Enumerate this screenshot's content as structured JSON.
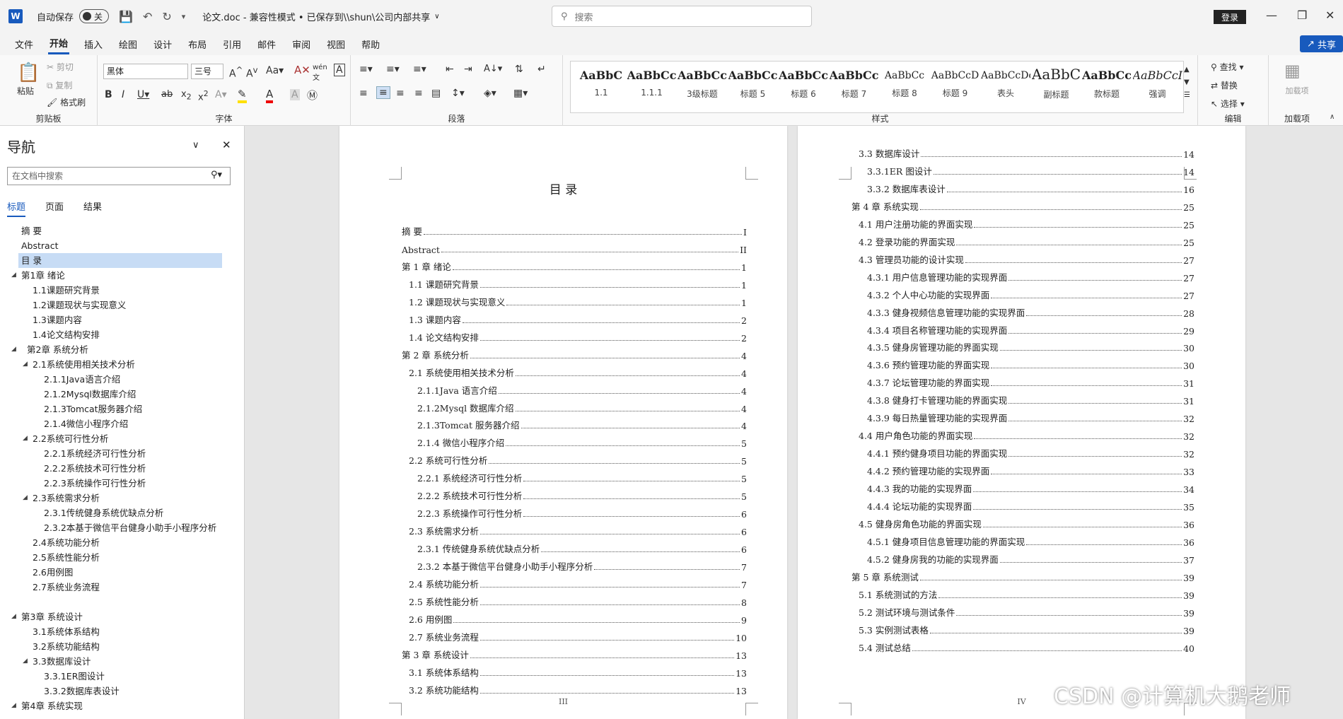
{
  "titlebar": {
    "autosave_label": "自动保存",
    "autosave_state": "关",
    "doc_title": "论文.doc  -  兼容性模式 • 已保存到\\\\shun\\公司内部共享",
    "search_placeholder": "搜索",
    "login": "登录"
  },
  "menu": [
    "文件",
    "开始",
    "插入",
    "绘图",
    "设计",
    "布局",
    "引用",
    "邮件",
    "审阅",
    "视图",
    "帮助"
  ],
  "share": "共享",
  "ribbon": {
    "clipboard": {
      "paste": "粘贴",
      "cut": "剪切",
      "copy": "复制",
      "format_painter": "格式刷",
      "label": "剪贴板"
    },
    "font": {
      "name": "黑体",
      "size": "三号",
      "label": "字体"
    },
    "paragraph": {
      "label": "段落"
    },
    "styles": {
      "label": "样式",
      "items": [
        {
          "sample": "AaBbC",
          "name": "1.1"
        },
        {
          "sample": "AaBbCcI",
          "name": "1.1.1"
        },
        {
          "sample": "AaBbCcI",
          "name": "3级标题"
        },
        {
          "sample": "AaBbCcI",
          "name": "标题 5"
        },
        {
          "sample": "AaBbCc",
          "name": "标题 6"
        },
        {
          "sample": "AaBbCcI",
          "name": "标题 7"
        },
        {
          "sample": "AaBbCc",
          "name": "标题 8"
        },
        {
          "sample": "AaBbCcD",
          "name": "标题 9"
        },
        {
          "sample": "AaBbCcDc",
          "name": "表头"
        },
        {
          "sample": "AaBbC",
          "name": "副标题"
        },
        {
          "sample": "AaBbCcI",
          "name": "款标题"
        },
        {
          "sample": "AaBbCcI",
          "name": "强调"
        }
      ]
    },
    "editing": {
      "find": "查找",
      "replace": "替换",
      "select": "选择",
      "label": "编辑"
    },
    "addins": {
      "addin": "加载项",
      "label": "加载项"
    }
  },
  "nav": {
    "title": "导航",
    "search_placeholder": "在文档中搜索",
    "tabs": [
      "标题",
      "页面",
      "结果"
    ],
    "items": [
      {
        "text": "摘  要",
        "level": 0
      },
      {
        "text": "Abstract",
        "level": 0
      },
      {
        "text": "目  录",
        "level": 0,
        "selected": true
      },
      {
        "text": "第1章 绪论",
        "level": 0,
        "arrow": true
      },
      {
        "text": "1.1课题研究背景",
        "level": 1
      },
      {
        "text": "1.2课题现状与实现意义",
        "level": 1
      },
      {
        "text": "1.3课题内容",
        "level": 1
      },
      {
        "text": "1.4论文结构安排",
        "level": 1
      },
      {
        "text": "第2章 系统分析",
        "level": 0,
        "arrow": true,
        "extra": true
      },
      {
        "text": "2.1系统使用相关技术分析",
        "level": 1,
        "arrow": true
      },
      {
        "text": "2.1.1Java语言介绍",
        "level": 2
      },
      {
        "text": "2.1.2Mysql数据库介绍",
        "level": 2
      },
      {
        "text": "2.1.3Tomcat服务器介绍",
        "level": 2
      },
      {
        "text": "2.1.4微信小程序介绍",
        "level": 2
      },
      {
        "text": "2.2系统可行性分析",
        "level": 1,
        "arrow": true
      },
      {
        "text": "2.2.1系统经济可行性分析",
        "level": 2
      },
      {
        "text": "2.2.2系统技术可行性分析",
        "level": 2
      },
      {
        "text": "2.2.3系统操作可行性分析",
        "level": 2
      },
      {
        "text": "2.3系统需求分析",
        "level": 1,
        "arrow": true
      },
      {
        "text": "2.3.1传统健身系统优缺点分析",
        "level": 2
      },
      {
        "text": "2.3.2本基于微信平台健身小助手小程序分析",
        "level": 2
      },
      {
        "text": "2.4系统功能分析",
        "level": 1
      },
      {
        "text": "2.5系统性能分析",
        "level": 1
      },
      {
        "text": "2.6用例图",
        "level": 1
      },
      {
        "text": "2.7系统业务流程",
        "level": 1
      },
      {
        "text": "",
        "level": 0
      },
      {
        "text": "第3章 系统设计",
        "level": 0,
        "arrow": true
      },
      {
        "text": "3.1系统体系结构",
        "level": 1
      },
      {
        "text": "3.2系统功能结构",
        "level": 1
      },
      {
        "text": "3.3数据库设计",
        "level": 1,
        "arrow": true
      },
      {
        "text": "3.3.1ER图设计",
        "level": 2
      },
      {
        "text": "3.3.2数据库表设计",
        "level": 2
      },
      {
        "text": "第4章 系统实现",
        "level": 0,
        "arrow": true
      }
    ]
  },
  "page1": {
    "heading": "目  录",
    "page_number": "III",
    "lines": [
      {
        "t": "摘    要",
        "p": "I",
        "i": 0
      },
      {
        "t": "Abstract",
        "p": "II",
        "i": 0
      },
      {
        "t": "第 1 章    绪论",
        "p": "1",
        "i": 0
      },
      {
        "t": "1.1 课题研究背景",
        "p": "1",
        "i": 1
      },
      {
        "t": "1.2 课题现状与实现意义",
        "p": "1",
        "i": 1
      },
      {
        "t": "1.3 课题内容",
        "p": "2",
        "i": 1
      },
      {
        "t": "1.4 论文结构安排",
        "p": "2",
        "i": 1
      },
      {
        "t": "第 2 章    系统分析",
        "p": "4",
        "i": 0
      },
      {
        "t": "2.1 系统使用相关技术分析",
        "p": "4",
        "i": 1
      },
      {
        "t": "2.1.1Java 语言介绍",
        "p": "4",
        "i": 2
      },
      {
        "t": "2.1.2Mysql 数据库介绍",
        "p": "4",
        "i": 2
      },
      {
        "t": "2.1.3Tomcat 服务器介绍",
        "p": "4",
        "i": 2
      },
      {
        "t": "2.1.4 微信小程序介绍",
        "p": "5",
        "i": 2
      },
      {
        "t": "2.2 系统可行性分析",
        "p": "5",
        "i": 1
      },
      {
        "t": "2.2.1 系统经济可行性分析",
        "p": "5",
        "i": 2
      },
      {
        "t": "2.2.2 系统技术可行性分析",
        "p": "5",
        "i": 2
      },
      {
        "t": "2.2.3 系统操作可行性分析",
        "p": "6",
        "i": 2
      },
      {
        "t": "2.3 系统需求分析",
        "p": "6",
        "i": 1
      },
      {
        "t": "2.3.1 传统健身系统优缺点分析",
        "p": "6",
        "i": 2
      },
      {
        "t": "2.3.2 本基于微信平台健身小助手小程序分析",
        "p": "7",
        "i": 2
      },
      {
        "t": "2.4 系统功能分析",
        "p": "7",
        "i": 1
      },
      {
        "t": "2.5 系统性能分析",
        "p": "8",
        "i": 1
      },
      {
        "t": "2.6 用例图",
        "p": "9",
        "i": 1
      },
      {
        "t": "2.7 系统业务流程",
        "p": "10",
        "i": 1
      },
      {
        "t": "第 3 章    系统设计",
        "p": "13",
        "i": 0
      },
      {
        "t": "3.1 系统体系结构",
        "p": "13",
        "i": 1
      },
      {
        "t": "3.2 系统功能结构",
        "p": "13",
        "i": 1
      }
    ]
  },
  "page2": {
    "page_number": "IV",
    "lines": [
      {
        "t": "3.3 数据库设计",
        "p": "14",
        "i": 1
      },
      {
        "t": "3.3.1ER 图设计",
        "p": "14",
        "i": 2
      },
      {
        "t": "3.3.2 数据库表设计",
        "p": "16",
        "i": 2
      },
      {
        "t": "第 4 章  系统实现",
        "p": "25",
        "i": 0
      },
      {
        "t": "4.1 用户注册功能的界面实现",
        "p": "25",
        "i": 1
      },
      {
        "t": "4.2 登录功能的界面实现",
        "p": "25",
        "i": 1
      },
      {
        "t": "4.3 管理员功能的设计实现",
        "p": "27",
        "i": 1
      },
      {
        "t": "4.3.1 用户信息管理功能的实现界面",
        "p": "27",
        "i": 2
      },
      {
        "t": "4.3.2  个人中心功能的实现界面",
        "p": "27",
        "i": 2
      },
      {
        "t": "4.3.3 健身视频信息管理功能的实现界面",
        "p": "28",
        "i": 2
      },
      {
        "t": "4.3.4 项目名称管理功能的实现界面",
        "p": "29",
        "i": 2
      },
      {
        "t": "4.3.5 健身房管理功能的界面实现",
        "p": "30",
        "i": 2
      },
      {
        "t": "4.3.6 预约管理功能的界面实现",
        "p": "30",
        "i": 2
      },
      {
        "t": "4.3.7 论坛管理功能的界面实现",
        "p": "31",
        "i": 2
      },
      {
        "t": "4.3.8 健身打卡管理功能的界面实现",
        "p": "31",
        "i": 2
      },
      {
        "t": "4.3.9 每日热量管理功能的实现界面",
        "p": "32",
        "i": 2
      },
      {
        "t": "4.4 用户角色功能的界面实现",
        "p": "32",
        "i": 1
      },
      {
        "t": "4.4.1  预约健身项目功能的界面实现",
        "p": "32",
        "i": 2
      },
      {
        "t": "4.4.2 预约管理功能的实现界面",
        "p": "33",
        "i": 2
      },
      {
        "t": "4.4.3 我的功能的实现界面",
        "p": "34",
        "i": 2
      },
      {
        "t": "4.4.4 论坛功能的实现界面",
        "p": "35",
        "i": 2
      },
      {
        "t": "4.5 健身房角色功能的界面实现",
        "p": "36",
        "i": 1
      },
      {
        "t": "4.5.1 健身项目信息管理功能的界面实现",
        "p": "36",
        "i": 2
      },
      {
        "t": "4.5.2 健身房我的功能的实现界面",
        "p": "37",
        "i": 2
      },
      {
        "t": "第 5 章  系统测试",
        "p": "39",
        "i": 0
      },
      {
        "t": "5.1 系统测试的方法",
        "p": "39",
        "i": 1
      },
      {
        "t": "5.2 测试环境与测试条件",
        "p": "39",
        "i": 1
      },
      {
        "t": "5.3 实例测试表格",
        "p": "39",
        "i": 1
      },
      {
        "t": "5.4 测试总结",
        "p": "40",
        "i": 1
      }
    ]
  },
  "watermark": "CSDN @计算机大鹅老师",
  "colors": {
    "accent": "#185abd",
    "selected": "#c7dcf5"
  }
}
